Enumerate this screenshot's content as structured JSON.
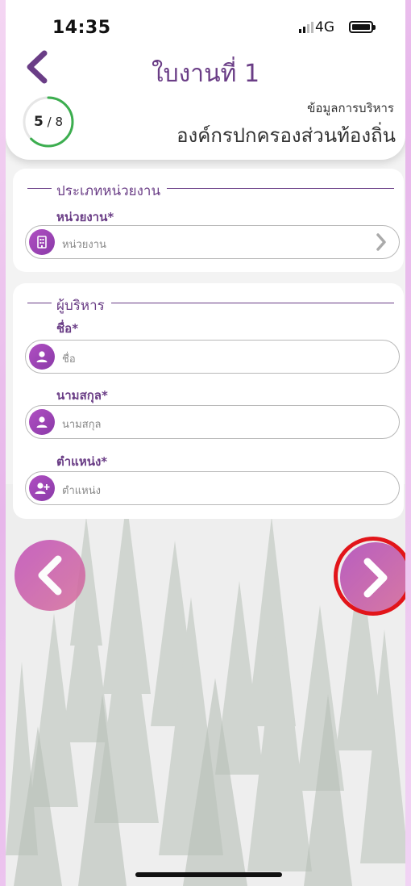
{
  "status_bar": {
    "time": "14:35",
    "network": "4G"
  },
  "header": {
    "title": "ใบงานที่ 1",
    "progress_current": "5",
    "progress_sep": " / ",
    "progress_total": "8",
    "progress_fraction": 0.625,
    "section_label": "ข้อมูลการบริหาร",
    "org_name": "องค์กรปกครองส่วนท้องถิ่น"
  },
  "card_unit": {
    "legend": "ประเภทหน่วยงาน",
    "unit_label": "หน่วยงาน*",
    "unit_placeholder": "หน่วยงาน"
  },
  "card_admin": {
    "legend": "ผู้บริหาร",
    "first_name_label": "ชื่อ*",
    "first_name_placeholder": "ชื่อ",
    "last_name_label": "นามสกุล*",
    "last_name_placeholder": "นามสกุล",
    "position_label": "ตำแหน่ง*",
    "position_placeholder": "ตำแหน่ง"
  },
  "colors": {
    "accent": "#6a3d86",
    "icon_gradient_start": "#b04fc2",
    "highlight": "#e2151a"
  },
  "icons": {
    "back": "chevron-left-icon",
    "unit": "building-icon",
    "person": "user-icon",
    "add_person": "user-plus-icon",
    "next": "chevron-right-icon"
  }
}
